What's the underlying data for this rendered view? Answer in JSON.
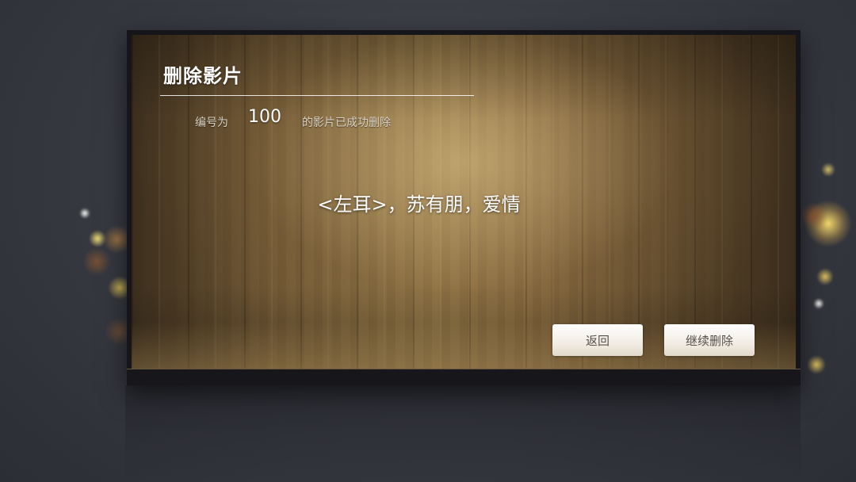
{
  "dialog": {
    "title": "删除影片",
    "message_prefix": "编号为",
    "movie_number": "100",
    "message_suffix": "的影片已成功删除",
    "movie_info": "<左耳>，苏有朋，爱情"
  },
  "buttons": {
    "back_label": "返回",
    "continue_delete_label": "继续删除"
  },
  "colors": {
    "background": "#3a3c44",
    "dialog_frame": "#15151a",
    "wood_light": "#8d7345",
    "wood_dark": "#3c2f1e",
    "text_primary": "#ffffff",
    "text_secondary": "#d8d2c4",
    "button_bg": "#f1f1f1",
    "button_text": "#444444"
  }
}
